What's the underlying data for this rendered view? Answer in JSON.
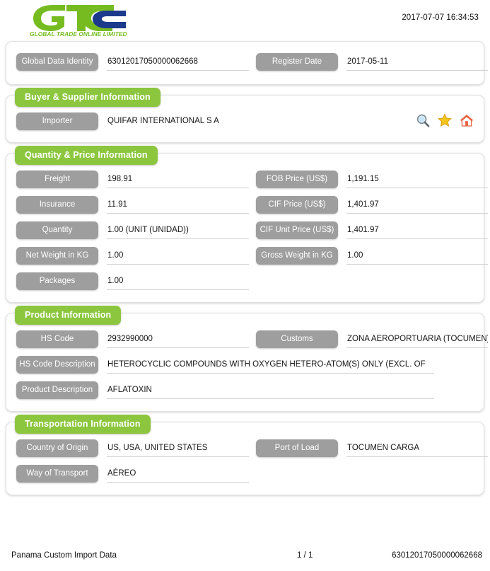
{
  "header": {
    "logo_text": "GLOBAL TRADE  ONLINE LIMITED",
    "logo_letters": "GTO",
    "timestamp": "2017-07-07 16:34:53"
  },
  "identity_card": {
    "fields": [
      {
        "label": "Global Data Identity",
        "value": "63012017050000062668"
      },
      {
        "label": "Register Date",
        "value": "2017-05-11"
      }
    ]
  },
  "buyer_supplier": {
    "title": "Buyer & Supplier Information",
    "fields": [
      {
        "label": "Importer",
        "value": "QUIFAR INTERNATIONAL S A"
      }
    ],
    "icons": [
      {
        "name": "search-icon",
        "label": "Search"
      },
      {
        "name": "star-icon",
        "label": "Favorite"
      },
      {
        "name": "home-icon",
        "label": "Home"
      }
    ]
  },
  "quantity_price": {
    "title": "Quantity & Price Information",
    "rows": [
      {
        "left_label": "Freight",
        "left_value": "198.91",
        "right_label": "FOB Price (US$)",
        "right_value": "1,191.15"
      },
      {
        "left_label": "Insurance",
        "left_value": "11.91",
        "right_label": "CIF Price (US$)",
        "right_value": "1,401.97"
      },
      {
        "left_label": "Quantity",
        "left_value": "1.00 (UNIT (UNIDAD))",
        "right_label": "CIF Unit Price (US$)",
        "right_value": "1,401.97"
      },
      {
        "left_label": "Net Weight in KG",
        "left_value": "1.00",
        "right_label": "Gross Weight in KG",
        "right_value": "1.00"
      },
      {
        "left_label": "Packages",
        "left_value": "1.00",
        "right_label": "",
        "right_value": ""
      }
    ]
  },
  "product": {
    "title": "Product Information",
    "rows": [
      {
        "left_label": "HS Code",
        "left_value": "2932990000",
        "right_label": "Customs",
        "right_value": "ZONA AEROPORTUARIA (TOCUMEN)"
      }
    ],
    "wide_rows": [
      {
        "label": "HS Code Description",
        "value": "HETEROCYCLIC COMPOUNDS WITH OXYGEN HETERO-ATOM(S) ONLY (EXCL. OF"
      },
      {
        "label": "Product Description",
        "value": "AFLATOXIN"
      }
    ]
  },
  "transportation": {
    "title": "Transportation Information",
    "rows": [
      {
        "left_label": "Country of Origin",
        "left_value": "US, USA, UNITED STATES",
        "right_label": "Port of Load",
        "right_value": "TOCUMEN CARGA"
      },
      {
        "left_label": "Way of Transport",
        "left_value": "AÉREO",
        "right_label": "",
        "right_value": ""
      }
    ]
  },
  "footer": {
    "source": "Panama Custom Import Data",
    "page": "1 / 1",
    "identity": "63012017050000062668"
  },
  "colors": {
    "green": "#8cc63e",
    "gray_chip": "#9e9e9e",
    "logo_blue": "#1b3a8c"
  }
}
